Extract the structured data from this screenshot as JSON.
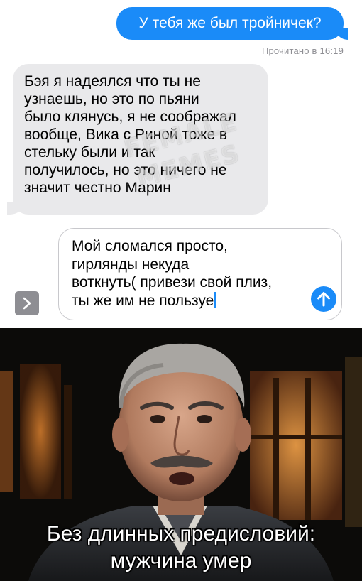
{
  "messages": {
    "sent_text": "У тебя же был тройничек?",
    "read_receipt": "Прочитано в 16:19",
    "received_text": "Бэя я надеялся что ты не\nузнаешь, но это по пьяни\nбыло клянусь, я не соображал\nвообще, Вика с Риной тоже в\nстельку были и так\nполучилось, но это ничего не\nзначит честно Марин"
  },
  "watermark": {
    "line1": "FEMALE",
    "line2": "MEMES"
  },
  "composer": {
    "draft_text": "Мой сломался просто,\nгирлянды некуда\nвоткнуть( привези свой плиз,\nты же им не пользуе"
  },
  "icons": {
    "expand": "chevron-right-icon",
    "send": "arrow-up-icon"
  },
  "meme": {
    "caption_line1": "Без длинных предисловий:",
    "caption_line2": "мужчина умер"
  },
  "colors": {
    "imessage_blue": "#1a8bf8",
    "received_bubble": "#e9e9eb",
    "muted_gray": "#8e8e93"
  }
}
